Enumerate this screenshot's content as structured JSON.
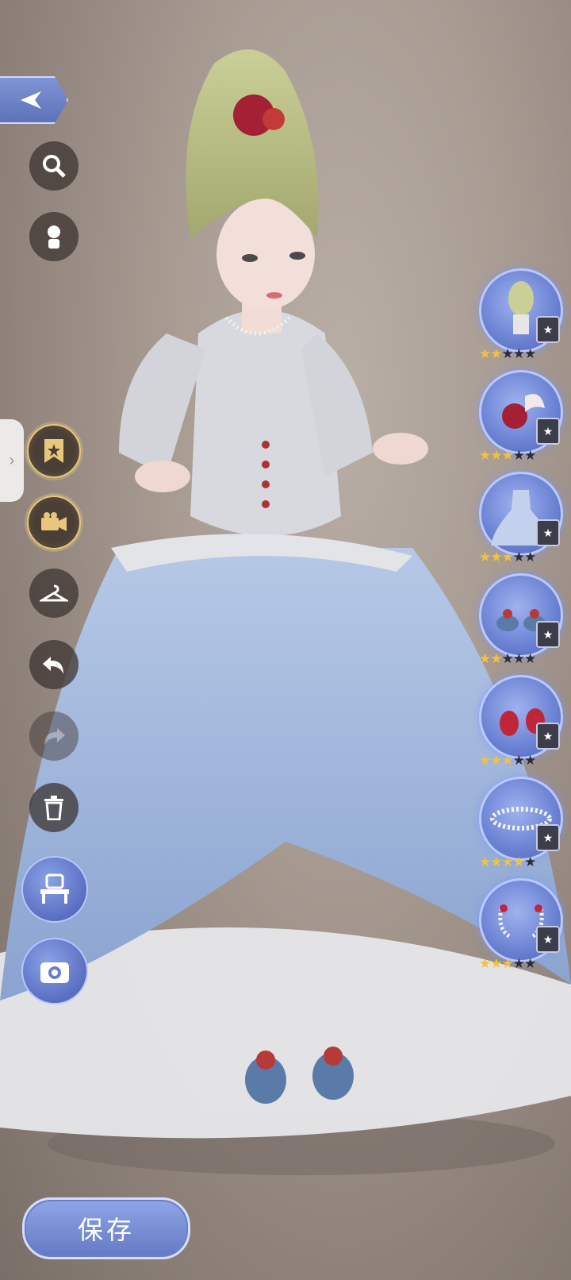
{
  "toolbar": {
    "back_icon": "back-arrow-icon",
    "items": [
      {
        "name": "search",
        "icon": "magnifier-icon"
      },
      {
        "name": "mannequin",
        "icon": "mannequin-icon"
      },
      {
        "name": "favorite",
        "icon": "star-bookmark-icon"
      },
      {
        "name": "camera-video",
        "icon": "video-camera-icon"
      },
      {
        "name": "hanger",
        "icon": "hanger-icon"
      },
      {
        "name": "undo",
        "icon": "undo-icon"
      },
      {
        "name": "redo",
        "icon": "redo-icon"
      },
      {
        "name": "delete",
        "icon": "trash-icon"
      },
      {
        "name": "vanity",
        "icon": "vanity-table-icon"
      },
      {
        "name": "screenshot",
        "icon": "camera-icon"
      }
    ]
  },
  "outfit_slots": [
    {
      "item": "hairstyle",
      "stars": 2,
      "max": 5
    },
    {
      "item": "hair-accessory",
      "stars": 3,
      "max": 5
    },
    {
      "item": "dress",
      "stars": 3,
      "max": 5
    },
    {
      "item": "shoes",
      "stars": 2,
      "max": 5
    },
    {
      "item": "earrings",
      "stars": 3,
      "max": 5
    },
    {
      "item": "necklace",
      "stars": 4,
      "max": 5
    },
    {
      "item": "bracelet",
      "stars": 3,
      "max": 5
    }
  ],
  "save_button": {
    "label": "保存"
  },
  "colors": {
    "accent": "#6f86d6",
    "gold": "#f1c23e",
    "dress": "#a8bfe2"
  }
}
